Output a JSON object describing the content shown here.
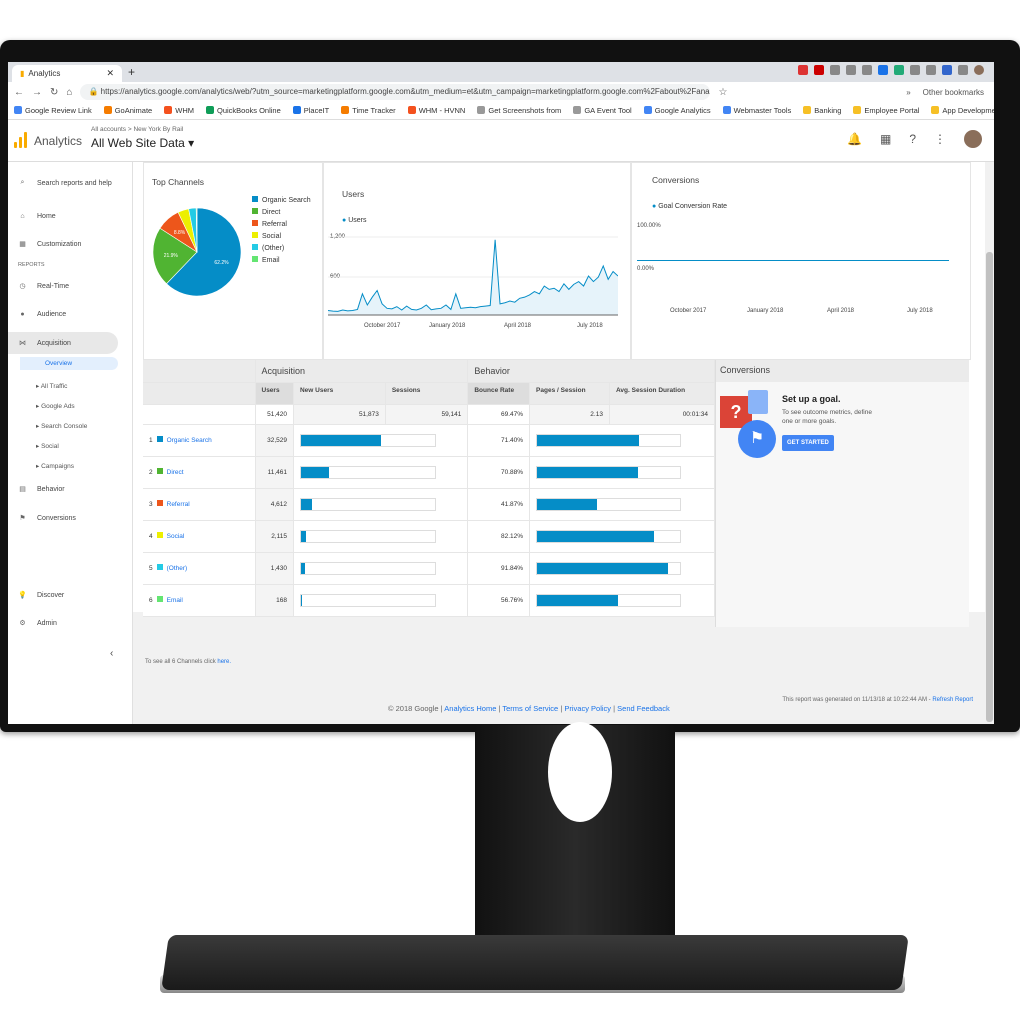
{
  "browser": {
    "tab_title": "Analytics",
    "url": "https://analytics.google.com/analytics/web/?utm_source=marketingplatform.google.com&utm_medium=et&utm_campaign=marketingplatform.google.com%2Fabout%2Fanalytics%2F#/report/traff...",
    "bookmarks": [
      "Google Review Link",
      "GoAnimate",
      "WHM",
      "QuickBooks Online",
      "PlaceIT",
      "Time Tracker",
      "WHM - HVNN",
      "Get Screenshots from",
      "GA Event Tool",
      "Google Analytics",
      "Webmaster Tools",
      "Banking",
      "Employee Portal",
      "App Development"
    ],
    "other_bookmarks": "Other bookmarks"
  },
  "header": {
    "app_name": "Analytics",
    "breadcrumb": "All accounts > New York By Rail",
    "property": "All Web Site Data ▾"
  },
  "sidebar": {
    "search": "Search reports and help",
    "home": "Home",
    "customization": "Customization",
    "reports_label": "REPORTS",
    "realtime": "Real-Time",
    "audience": "Audience",
    "acquisition": "Acquisition",
    "overview": "Overview",
    "sub": [
      "All Traffic",
      "Google Ads",
      "Search Console",
      "Social",
      "Campaigns"
    ],
    "behavior": "Behavior",
    "conversions": "Conversions",
    "discover": "Discover",
    "admin": "Admin"
  },
  "top_channels": {
    "title": "Top Channels",
    "legend": [
      "Organic Search",
      "Direct",
      "Referral",
      "Social",
      "(Other)",
      "Email"
    ],
    "colors": [
      "#058dc7",
      "#50b432",
      "#ed561b",
      "#edef00",
      "#24cbe5",
      "#64e572"
    ],
    "percent": [
      63.3,
      22.3,
      9.0,
      4.1,
      2.8,
      0.3
    ],
    "labels": [
      "62.2%",
      "21.9%",
      "8.8%"
    ]
  },
  "users_chart": {
    "title": "Users",
    "series": "Users",
    "y_ticks": [
      "1,200",
      "600"
    ],
    "x_ticks": [
      "October 2017",
      "January 2018",
      "April 2018",
      "July 2018"
    ],
    "values": [
      80,
      70,
      65,
      90,
      75,
      80,
      100,
      380,
      180,
      320,
      440,
      200,
      120,
      110,
      150,
      90,
      160,
      100,
      90,
      120,
      180,
      95,
      110,
      120,
      180,
      100,
      380,
      120,
      130,
      140,
      130,
      150,
      160,
      170,
      1350,
      200,
      220,
      250,
      230,
      300,
      320,
      360,
      420,
      380,
      520,
      460,
      480,
      420,
      560,
      460,
      550,
      600,
      520,
      700,
      600,
      680,
      880,
      640,
      780,
      700
    ]
  },
  "conversions_chart": {
    "title": "Conversions",
    "series": "Goal Conversion Rate",
    "y_ticks": [
      "100.00%",
      "0.00%"
    ],
    "x_ticks": [
      "October 2017",
      "January 2018",
      "April 2018",
      "July 2018"
    ]
  },
  "table": {
    "group_acq": "Acquisition",
    "group_beh": "Behavior",
    "group_conv": "Conversions",
    "cols": [
      "Users",
      "New Users",
      "Sessions",
      "Bounce Rate",
      "Pages / Session",
      "Avg. Session Duration"
    ],
    "totals": [
      "51,420",
      "51,873",
      "59,141",
      "69.47%",
      "2.13",
      "00:01:34"
    ],
    "rows": [
      {
        "rank": "1",
        "channel": "Organic Search",
        "users": "32,529",
        "users_n": 32529,
        "bounce": "71.40%",
        "bounce_n": 71.4
      },
      {
        "rank": "2",
        "channel": "Direct",
        "users": "11,461",
        "users_n": 11461,
        "bounce": "70.88%",
        "bounce_n": 70.88
      },
      {
        "rank": "3",
        "channel": "Referral",
        "users": "4,612",
        "users_n": 4612,
        "bounce": "41.87%",
        "bounce_n": 41.87
      },
      {
        "rank": "4",
        "channel": "Social",
        "users": "2,115",
        "users_n": 2115,
        "bounce": "82.12%",
        "bounce_n": 82.12
      },
      {
        "rank": "5",
        "channel": "(Other)",
        "users": "1,430",
        "users_n": 1430,
        "bounce": "91.84%",
        "bounce_n": 91.84
      },
      {
        "rank": "6",
        "channel": "Email",
        "users": "168",
        "users_n": 168,
        "bounce": "56.76%",
        "bounce_n": 56.76
      }
    ],
    "see_all": "To see all 6 Channels click",
    "here": "here."
  },
  "goal": {
    "title": "Set up a goal.",
    "text": "To see outcome metrics, define one or more goals.",
    "button": "GET STARTED"
  },
  "report_note": "This report was generated on 11/13/18 at 10:22:44 AM -",
  "refresh": "Refresh Report",
  "footer": {
    "copyright": "© 2018 Google |",
    "links": [
      "Analytics Home",
      "Terms of Service",
      "Privacy Policy",
      "Send Feedback"
    ]
  }
}
